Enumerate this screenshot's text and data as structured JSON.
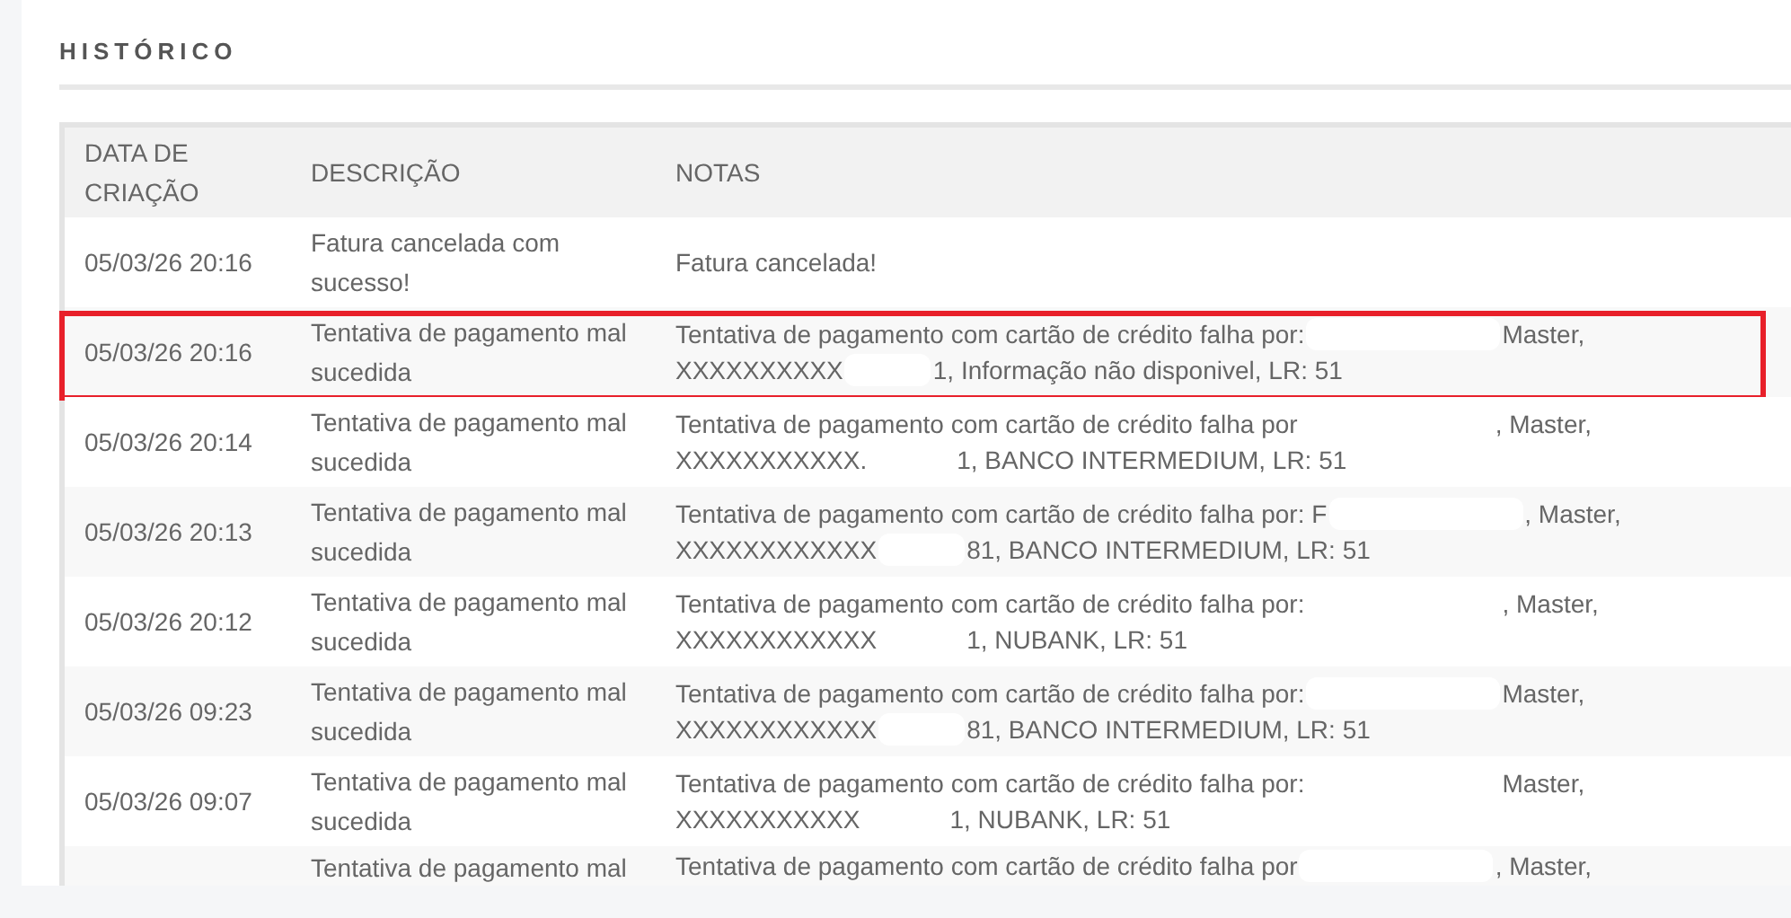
{
  "section": {
    "title": "HISTÓRICO"
  },
  "table": {
    "columns": [
      "DATA DE CRIAÇÃO",
      "DESCRIÇÃO",
      "NOTAS"
    ],
    "rows": [
      {
        "date": "05/03/26 20:16",
        "description": "Fatura cancelada com sucesso!",
        "notes": {
          "line1": [
            "Fatura cancelada!"
          ]
        },
        "highlighted": false
      },
      {
        "date": "05/03/26 20:16",
        "description": "Tentativa de pagamento mal sucedida",
        "notes": {
          "line1": [
            "Tentativa de pagamento com cartão de crédito falha por:",
            "Master,"
          ],
          "line2": [
            "XXXXXXXXXX",
            "1, Informação não disponivel, LR: 51"
          ]
        },
        "highlighted": true
      },
      {
        "date": "05/03/26 20:14",
        "description": "Tentativa de pagamento mal sucedida",
        "notes": {
          "line1": [
            "Tentativa de pagamento com cartão de crédito falha por",
            ", Master,"
          ],
          "line2": [
            "XXXXXXXXXXX.",
            "1, BANCO INTERMEDIUM, LR: 51"
          ]
        },
        "highlighted": false
      },
      {
        "date": "05/03/26 20:13",
        "description": "Tentativa de pagamento mal sucedida",
        "notes": {
          "line1": [
            "Tentativa de pagamento com cartão de crédito falha por: F",
            ", Master,"
          ],
          "line2": [
            "XXXXXXXXXXXX",
            "81, BANCO INTERMEDIUM, LR: 51"
          ]
        },
        "highlighted": false
      },
      {
        "date": "05/03/26 20:12",
        "description": "Tentativa de pagamento mal sucedida",
        "notes": {
          "line1": [
            "Tentativa de pagamento com cartão de crédito falha por:",
            ", Master,"
          ],
          "line2": [
            "XXXXXXXXXXXX",
            "1, NUBANK, LR: 51"
          ]
        },
        "highlighted": false
      },
      {
        "date": "05/03/26 09:23",
        "description": "Tentativa de pagamento mal sucedida",
        "notes": {
          "line1": [
            "Tentativa de pagamento com cartão de crédito falha por:",
            "Master,"
          ],
          "line2": [
            "XXXXXXXXXXXX",
            "81, BANCO INTERMEDIUM, LR: 51"
          ]
        },
        "highlighted": false
      },
      {
        "date": "05/03/26 09:07",
        "description": "Tentativa de pagamento mal sucedida",
        "notes": {
          "line1": [
            "Tentativa de pagamento com cartão de crédito falha por:",
            "Master,"
          ],
          "line2": [
            "XXXXXXXXXXX",
            "1, NUBANK, LR: 51"
          ]
        },
        "highlighted": false
      },
      {
        "description": "Tentativa de pagamento mal",
        "notes": {
          "line1": [
            "Tentativa de pagamento com cartão de crédito falha por",
            ", Master,"
          ]
        },
        "highlighted": false
      }
    ]
  }
}
